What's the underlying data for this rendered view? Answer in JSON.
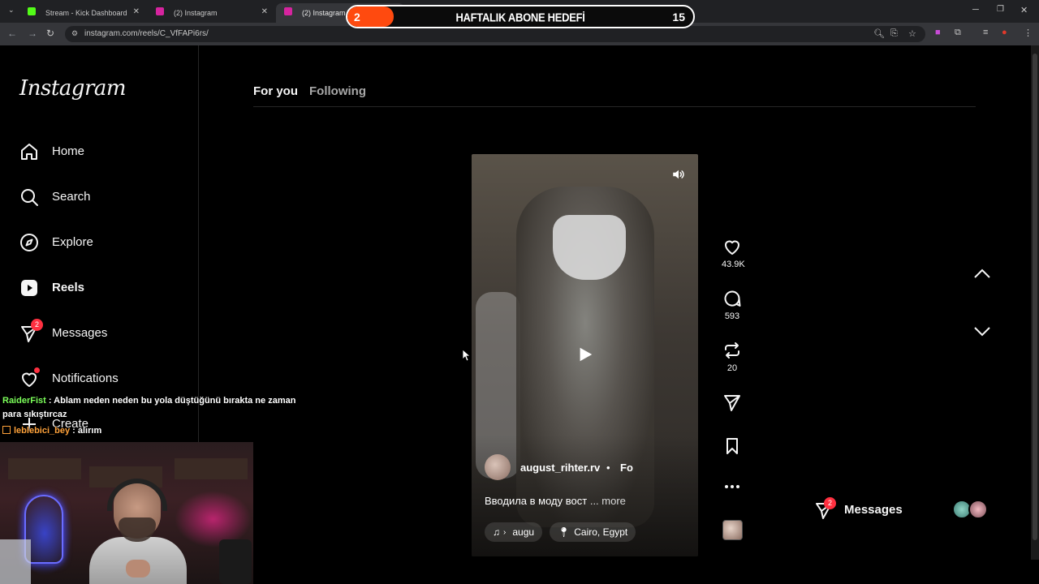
{
  "browser": {
    "tabs": [
      {
        "title": "Stream - Kick Dashboard",
        "favicon_color": "#53fc18"
      },
      {
        "title": "(2) Instagram",
        "favicon_color": "#d6249f"
      },
      {
        "title": "(2) Instagram",
        "favicon_color": "#d6249f",
        "active": true
      }
    ],
    "new_tab": "+",
    "url": "instagram.com/reels/C_VfFAPi6rs/"
  },
  "stream_overlay": {
    "current": "2",
    "title": "HAFTALIK ABONE HEDEFİ",
    "target": "15",
    "progress": 0.133,
    "fill_color": "#ff4a0f"
  },
  "sidebar": {
    "logo": "Instagram",
    "items": [
      {
        "label": "Home",
        "icon": "home-icon"
      },
      {
        "label": "Search",
        "icon": "search-icon"
      },
      {
        "label": "Explore",
        "icon": "compass-icon"
      },
      {
        "label": "Reels",
        "icon": "reels-icon",
        "active": true
      },
      {
        "label": "Messages",
        "icon": "messenger-icon",
        "badge": "2"
      },
      {
        "label": "Notifications",
        "icon": "heart-icon",
        "dot": true
      },
      {
        "label": "Create",
        "icon": "plus-icon"
      }
    ]
  },
  "feed_tabs": {
    "for_you": "For you",
    "following": "Following"
  },
  "reel": {
    "author": "august_rihter.rv",
    "separator": "•",
    "follow": "Fo",
    "caption": "Вводила в моду вост",
    "more": "... more",
    "audio": "augu",
    "location": "Cairo, Egypt"
  },
  "actions": {
    "likes": "43.9K",
    "comments": "593",
    "reposts": "20"
  },
  "messages_fab": {
    "label": "Messages",
    "badge": "2"
  },
  "chat": [
    {
      "user": "RaiderFist",
      "sep": " : ",
      "text": "Ablam neden neden bu yola düştüğünü bırakta ne zaman para sıkıştırcaz"
    },
    {
      "user": "leblebici_bey",
      "sep": " : ",
      "text": "alırım"
    }
  ]
}
